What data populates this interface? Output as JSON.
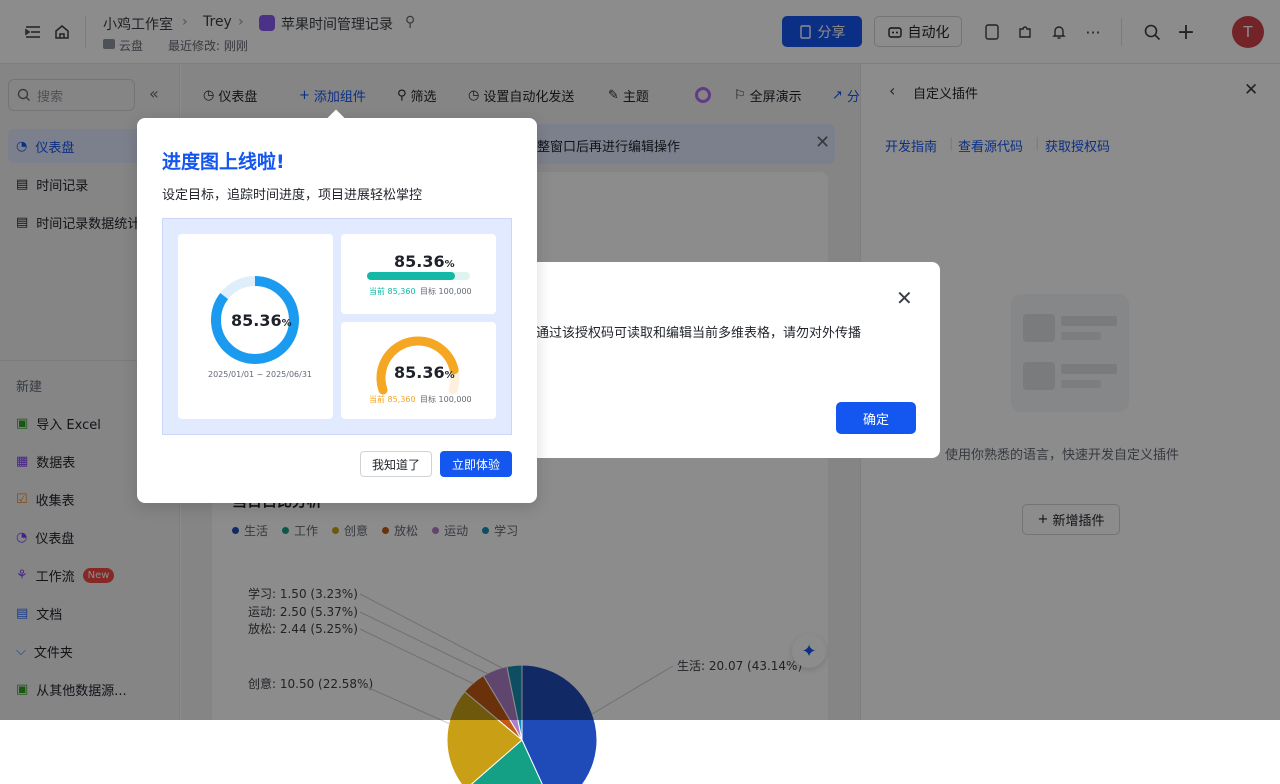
{
  "header": {
    "breadcrumb": [
      "小鸡工作室",
      "Trey",
      "苹果时间管理记录"
    ],
    "location": "云盘",
    "last_modified": "最近修改: 刚刚",
    "share_label": "分享",
    "automation_label": "自动化",
    "avatar_letter": "T"
  },
  "sidebar": {
    "search_placeholder": "搜索",
    "items": [
      {
        "label": "仪表盘",
        "active": true
      },
      {
        "label": "时间记录"
      },
      {
        "label": "时间记录数据统计"
      }
    ],
    "new_label": "新建",
    "new_items": [
      {
        "label": "导入 Excel"
      },
      {
        "label": "数据表"
      },
      {
        "label": "收集表"
      },
      {
        "label": "仪表盘"
      },
      {
        "label": "工作流",
        "badge": "New"
      },
      {
        "label": "文档"
      },
      {
        "label": "文件夹"
      },
      {
        "label": "从其他数据源..."
      }
    ]
  },
  "toolbar": {
    "dashboard": "仪表盘",
    "add_widget": "添加组件",
    "filter": "筛选",
    "auto_send": "设置自动化发送",
    "theme": "主题",
    "fullscreen": "全屏演示",
    "share_partial": "分"
  },
  "banner": {
    "text": "整窗口后再进行编辑操作"
  },
  "chart_card": {
    "title_partial": "当日占比分析"
  },
  "chart_data": {
    "type": "pie",
    "legend": [
      "生活",
      "工作",
      "创意",
      "放松",
      "运动",
      "学习"
    ],
    "colors": [
      "#1f4bb8",
      "#14a085",
      "#c9a015",
      "#c15a14",
      "#b07fc9",
      "#1a8fb5"
    ],
    "labels": [
      {
        "name": "学习",
        "text": "学习: 1.50 (3.23%)"
      },
      {
        "name": "运动",
        "text": "运动: 2.50 (5.37%)"
      },
      {
        "name": "放松",
        "text": "放松: 2.44 (5.25%)"
      },
      {
        "name": "创意",
        "text": "创意: 10.50 (22.58%)"
      },
      {
        "name": "生活",
        "text": "生活: 20.07 (43.14%)"
      }
    ],
    "values": [
      {
        "name": "生活",
        "value": 20.07,
        "percent": 43.14
      },
      {
        "name": "工作",
        "value": 9.49,
        "percent": 20.43
      },
      {
        "name": "创意",
        "value": 10.5,
        "percent": 22.58
      },
      {
        "name": "放松",
        "value": 2.44,
        "percent": 5.25
      },
      {
        "name": "运动",
        "value": 2.5,
        "percent": 5.37
      },
      {
        "name": "学习",
        "value": 1.5,
        "percent": 3.23
      }
    ]
  },
  "right_panel": {
    "title": "自定义插件",
    "links": [
      "开发指南",
      "查看源代码",
      "获取授权码"
    ],
    "description": "使用你熟悉的语言，快速开发自定义插件",
    "add_button": "新增插件"
  },
  "dialog": {
    "text": "通过该授权码可读取和编辑当前多维表格，请勿对外传播",
    "ok_label": "确定"
  },
  "popup": {
    "title": "进度图上线啦!",
    "subtitle": "设定目标，追踪时间进度，项目进展轻松掌控",
    "preview": {
      "ring_value": "85.36",
      "unit": "%",
      "date_range": "2025/01/01 ~ 2025/06/31",
      "current_label": "当前 85,360",
      "target_label": "目标 100,000",
      "progress_fraction": 0.8536
    },
    "dismiss_label": "我知道了",
    "try_label": "立即体验"
  },
  "colors": {
    "accent": "#1456f0",
    "ring": "#1a9bf0",
    "bar": "#14b8a6",
    "gauge": "#f5a623"
  }
}
